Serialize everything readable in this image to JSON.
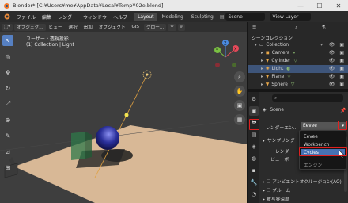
{
  "title_bar": {
    "title": "Blender* [C:¥Users¥me¥AppData¥Local¥Temp¥02e.blend]",
    "minimize": "—",
    "maximize": "☐",
    "close": "✕"
  },
  "menu": {
    "items": [
      "ファイル",
      "編集",
      "レンダー",
      "ウィンドウ",
      "ヘルプ"
    ],
    "workspace_tabs": [
      "Layout",
      "Modeling",
      "Sculpting"
    ],
    "active_tab": "Layout",
    "scene_name": "Scene",
    "view_layer": "View Layer"
  },
  "viewport_header": {
    "mode": "オブジェク…",
    "items": [
      "ビュー",
      "選択",
      "追加",
      "オブジェクト"
    ],
    "gis": "GIS",
    "orientation": "グロー…"
  },
  "viewport": {
    "view_name": "ユーザー・透視投影",
    "collection_info": "(1) Collection | Light",
    "gizmo_axes": {
      "x": "X",
      "y": "Y",
      "z": "Z"
    }
  },
  "outliner": {
    "header": "シーンコレクション",
    "collection": "Collection",
    "objects": [
      {
        "name": "Camera",
        "color": "#e8a84a"
      },
      {
        "name": "Cylinder",
        "color": "#e8a84a"
      },
      {
        "name": "Light",
        "color": "#e8a84a"
      },
      {
        "name": "Plane",
        "color": "#e8a84a"
      },
      {
        "name": "Sphere",
        "color": "#e8a84a"
      }
    ],
    "selected": "Light"
  },
  "properties": {
    "context": "Scene",
    "render_engine_label": "レンダーエン…",
    "render_engine_value": "Eevee",
    "sampling_label": "サンプリング",
    "render_label": "レンダ",
    "viewport_label": "ビューポー",
    "ao_label": "アンビエントオクルージョン(AO)",
    "bloom_label": "ブルーム",
    "dof_label": "被写界深度"
  },
  "dropdown": {
    "items": [
      "Eevee",
      "Workbench",
      "Cycles"
    ],
    "highlighted": "Cycles",
    "footer": "エンジン"
  },
  "colors": {
    "accent": "#4772b3",
    "selection": "#3e557a",
    "annotation": "#e02020",
    "floor": "#d8b896",
    "cube": "#2f7a4a",
    "sphere": "#2a2f9a"
  }
}
